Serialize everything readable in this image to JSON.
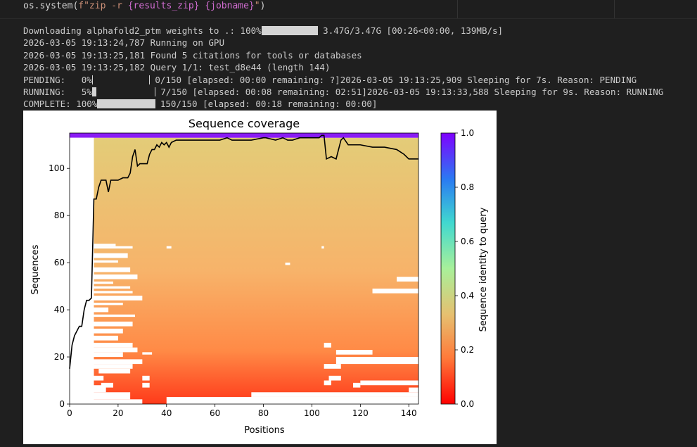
{
  "code_cell": {
    "prefix": "os.system(",
    "fstring_prefix": "f\"zip -r ",
    "brace1": "{results_zip}",
    "space": " ",
    "brace2": "{jobname}",
    "suffix_quote": "\"",
    "suffix_paren": ")"
  },
  "log": {
    "download_prefix": "Downloading alphafold2_ptm weights to .: 100%",
    "download_suffix": " 3.47G/3.47G [00:26<00:00, 139MB/s]",
    "line2": "2026-03-05 19:13:24,787 Running on GPU",
    "line3": "2026-03-05 19:13:25,181 Found 5 citations for tools or databases",
    "line4": "2026-03-05 19:13:25,182 Query 1/1: test_d8e44 (length 144)",
    "pending_prefix": "PENDING:   0%",
    "pending_suffix": " 0/150 [elapsed: 00:00 remaining: ?]2026-03-05 19:13:25,909 Sleeping for 7s. Reason: PENDING",
    "pending_progress": 0,
    "running_prefix": "RUNNING:   5%",
    "running_suffix": " 7/150 [elapsed: 00:08 remaining: 02:51]2026-03-05 19:13:33,588 Sleeping for 9s. Reason: RUNNING",
    "running_progress": 0.05,
    "complete_prefix": "COMPLETE: 100%",
    "complete_suffix": " 150/150 [elapsed: 00:18 remaining: 00:00]",
    "complete_progress": 1.0
  },
  "chart_data": {
    "type": "heatmap",
    "title": "Sequence coverage",
    "xlabel": "Positions",
    "ylabel": "Sequences",
    "xlim": [
      0,
      144
    ],
    "ylim": [
      0,
      115
    ],
    "xticks": [
      "0",
      "20",
      "40",
      "60",
      "80",
      "100",
      "120",
      "140"
    ],
    "yticks": [
      "0",
      "20",
      "40",
      "60",
      "80",
      "100"
    ],
    "colorbar_label": "Sequence identity to query",
    "colorbar_ticks": [
      "0.0",
      "0.2",
      "0.4",
      "0.6",
      "0.8",
      "1.0"
    ],
    "colormap": "rainbow_r",
    "query_row_identity": 1.0,
    "coverage_line": {
      "x": [
        0,
        1,
        2,
        3,
        4,
        5,
        6,
        7,
        8,
        9,
        10,
        11,
        12,
        13,
        14,
        15,
        16,
        17,
        18,
        19,
        20,
        22,
        24,
        25,
        26,
        27,
        28,
        29,
        30,
        32,
        33,
        34,
        35,
        36,
        37,
        38,
        39,
        40,
        41,
        42,
        44,
        46,
        50,
        60,
        62,
        65,
        67,
        70,
        75,
        80,
        81,
        85,
        88,
        90,
        92,
        95,
        100,
        103,
        104,
        105,
        106,
        108,
        110,
        112,
        113,
        115,
        120,
        125,
        130,
        135,
        138,
        140,
        144
      ],
      "y": [
        15,
        25,
        29,
        31,
        33,
        33,
        40,
        44,
        44,
        45,
        87,
        87,
        92,
        95,
        95,
        95,
        90,
        95,
        95,
        95,
        95,
        96,
        96,
        98,
        105,
        108,
        101,
        102,
        102,
        102,
        106,
        108,
        108,
        110,
        109,
        111,
        110,
        111,
        109,
        111,
        112,
        112,
        112,
        112,
        112,
        113,
        112,
        112,
        112,
        113,
        113,
        112,
        113,
        112,
        112,
        113,
        113,
        113,
        114,
        114,
        104,
        105,
        104,
        112,
        113,
        110,
        110,
        109,
        109,
        108,
        106,
        104,
        104
      ]
    }
  }
}
